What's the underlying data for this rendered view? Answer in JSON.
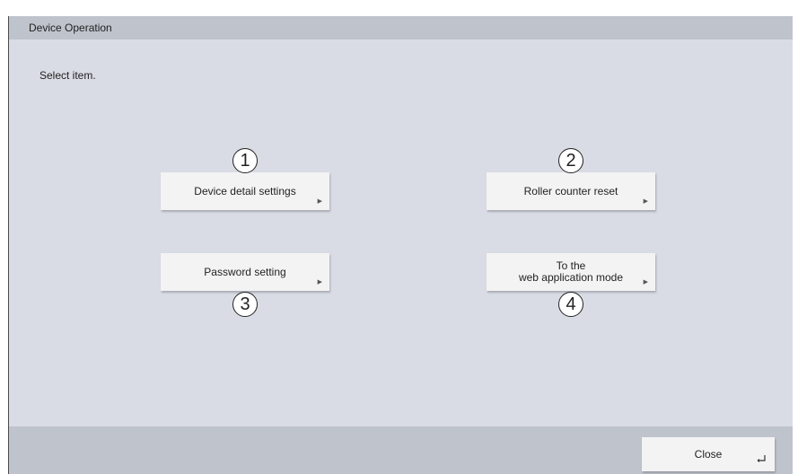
{
  "window": {
    "title": "Device Operation",
    "instruction": "Select item."
  },
  "buttons": [
    {
      "label": "Device detail settings",
      "marker": "1",
      "icon": "triangle-right-icon"
    },
    {
      "label": "Roller counter reset",
      "marker": "2",
      "icon": "triangle-right-icon"
    },
    {
      "label": "Password setting",
      "marker": "3",
      "icon": "triangle-right-icon"
    },
    {
      "label": "To the\nweb application mode",
      "marker": "4",
      "icon": "triangle-right-icon"
    }
  ],
  "footer": {
    "close_label": "Close",
    "close_icon": "enter-icon"
  },
  "colors": {
    "window_background": "#d9dce4",
    "bar_background": "#bfc3cc",
    "button_background": "#f3f3f4"
  }
}
